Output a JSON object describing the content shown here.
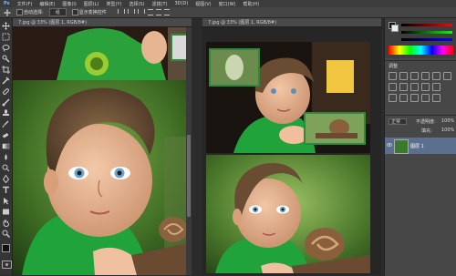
{
  "menubar": {
    "items": [
      "文件(F)",
      "编辑(E)",
      "图像(I)",
      "图层(L)",
      "类型(Y)",
      "选择(S)",
      "滤镜(T)",
      "3D(D)",
      "视图(V)",
      "窗口(W)",
      "帮助(H)"
    ]
  },
  "options": {
    "auto_select": "自动选择:",
    "layer_value": "组",
    "show_transform": "显示变换控件"
  },
  "doc_left": {
    "tab_title": "7.jpg @ 33% (图层 1, RGB/8#)"
  },
  "doc_right": {
    "tab_title": "7.jpg @ 33% (图层 1, RGB/8#)"
  },
  "adjustments": {
    "title": "调整"
  },
  "layers": {
    "mode_label": "正常",
    "opacity_label": "不透明度:",
    "opacity_value": "100%",
    "fill_label": "填充:",
    "fill_value": "100%",
    "layer1_name": "图层 1"
  },
  "colors": {
    "accent_green": "#2b8a3e",
    "layer_highlight": "#5c6f8e",
    "panel_bg": "#474747"
  },
  "icons": [
    "move-icon",
    "marquee-icon",
    "lasso-icon",
    "quick-select-icon",
    "crop-icon",
    "eyedropper-icon",
    "healing-icon",
    "brush-icon",
    "stamp-icon",
    "history-brush-icon",
    "eraser-icon",
    "gradient-icon",
    "blur-icon",
    "dodge-icon",
    "pen-icon",
    "type-icon",
    "path-select-icon",
    "shape-icon",
    "hand-icon",
    "zoom-icon"
  ]
}
